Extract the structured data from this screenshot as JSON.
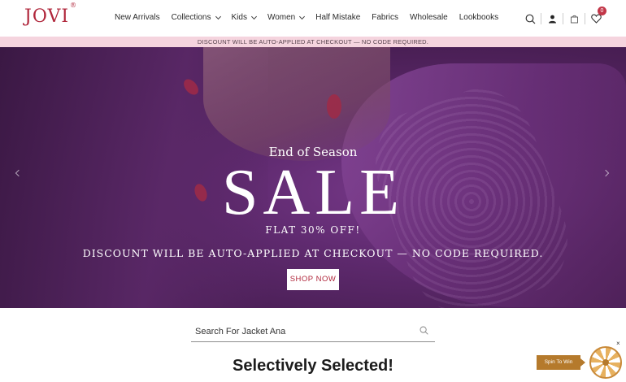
{
  "header": {
    "logo": "JOVI",
    "logo_mark": "®",
    "nav": [
      {
        "label": "New Arrivals",
        "dropdown": false
      },
      {
        "label": "Collections",
        "dropdown": true
      },
      {
        "label": "Kids",
        "dropdown": true
      },
      {
        "label": "Women",
        "dropdown": true
      },
      {
        "label": "Half Mistake",
        "dropdown": false
      },
      {
        "label": "Fabrics",
        "dropdown": false
      },
      {
        "label": "Wholesale",
        "dropdown": false
      },
      {
        "label": "Lookbooks",
        "dropdown": false
      }
    ],
    "icons": [
      "search-icon",
      "user-icon",
      "cart-icon",
      "heart-icon"
    ],
    "wishlist_count": "0"
  },
  "announcement": "DISCOUNT WILL BE AUTO-APPLIED AT CHECKOUT — NO CODE REQUIRED.",
  "hero": {
    "eyebrow": "End of Season",
    "headline": "SALE",
    "offer": "FLAT 30% OFF!",
    "note": "DISCOUNT WILL BE AUTO-APPLIED AT CHECKOUT — NO CODE REQUIRED.",
    "cta": "SHOP NOW"
  },
  "search": {
    "placeholder": "Search For Jacket Ana"
  },
  "section_title": "Selectively Selected!",
  "spin": {
    "label": "Spin To Win",
    "close": "×"
  },
  "colors": {
    "brand": "#b0263b",
    "announcement_bg": "#f5d4de",
    "hero_bg": "#5f2a6f",
    "badge": "#c23648",
    "spin": "#b57a2c"
  }
}
